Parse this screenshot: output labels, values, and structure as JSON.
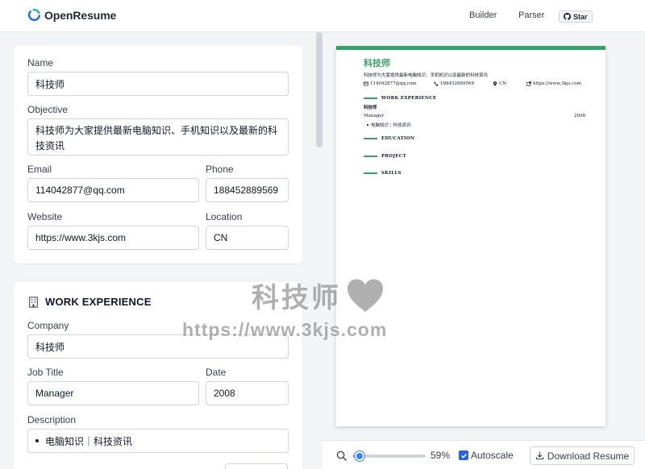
{
  "app": {
    "title": "OpenResume",
    "nav": {
      "builder": "Builder",
      "parser": "Parser",
      "star": "Star"
    }
  },
  "form": {
    "profile": {
      "name_label": "Name",
      "name_value": "科技师",
      "objective_label": "Objective",
      "objective_value": "科技师为大家提供最新电脑知识、手机知识以及最新的科技资讯",
      "email_label": "Email",
      "email_value": "114042877@qq.com",
      "phone_label": "Phone",
      "phone_value": "188452889569",
      "website_label": "Website",
      "website_value": "https://www.3kjs.com",
      "location_label": "Location",
      "location_value": "CN"
    },
    "work": {
      "section_title": "WORK EXPERIENCE",
      "company_label": "Company",
      "company_value": "科技师",
      "job_title_label": "Job Title",
      "job_title_value": "Manager",
      "date_label": "Date",
      "date_value": "2008",
      "description_label": "Description",
      "description_items": [
        "电脑知识｜科技资讯"
      ]
    }
  },
  "preview": {
    "name": "科技师",
    "objective": "科技师为大家提供最新电脑知识、手机知识以及最新的科技资讯",
    "email": "114042877@qq.com",
    "phone": "188452889569",
    "location": "CN",
    "website": "https://www.3kjs.com",
    "sections": {
      "work": "WORK EXPERIENCE",
      "education": "EDUCATION",
      "project": "PROJECT",
      "skills": "SKILLS"
    },
    "work_company": "科技师",
    "work_title": "Manager",
    "work_date": "2008",
    "work_bullet": "电脑知识｜科技资讯",
    "accent_color": "#38a169"
  },
  "toolbar": {
    "zoom_percent": 59,
    "zoom_label": "59%",
    "autoscale_label": "Autoscale",
    "autoscale_checked": true,
    "download_label": "Download Resume"
  },
  "watermark": {
    "line1": "科技师",
    "line2": "https://www.3kjs.com"
  },
  "colors": {
    "primary": "#3b82f6",
    "checkbox": "#2563eb",
    "logo_blue": "#2f6fd6",
    "logo_teal": "#38b2ac"
  }
}
